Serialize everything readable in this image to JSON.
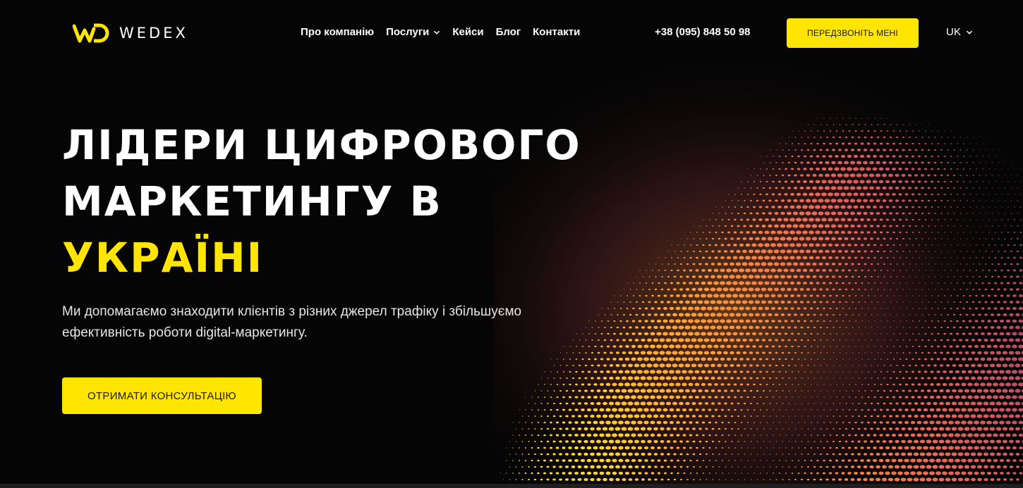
{
  "brand": {
    "name": "WEDEX",
    "accent_color": "#ffe500",
    "background_color": "#050505"
  },
  "header": {
    "nav": [
      {
        "label": "Про компанію"
      },
      {
        "label": "Послуги",
        "has_dropdown": true
      },
      {
        "label": "Кейси"
      },
      {
        "label": "Блог"
      },
      {
        "label": "Контакти"
      }
    ],
    "phone": "+38 (095) 848 50 98",
    "callback_button": "ПЕРЕДЗВОНІТЬ МЕНІ",
    "language": "UK"
  },
  "hero": {
    "title_line1": "ЛІДЕРИ ЦИФРОВОГО",
    "title_line2": "МАРКЕТИНГУ В",
    "title_accent": "УКРАЇНІ",
    "subtitle": "Ми допомагаємо знаходити клієнтів з різних джерел трафіку і збільшуємо ефективність роботи digital-маркетингу.",
    "cta_button": "ОТРИМАТИ КОНСУЛЬТАЦІЮ"
  },
  "icons": {
    "logo": "wedex-logo-icon",
    "dropdown": "chevron-down-icon",
    "decor": "halftone-wave-graphic"
  }
}
